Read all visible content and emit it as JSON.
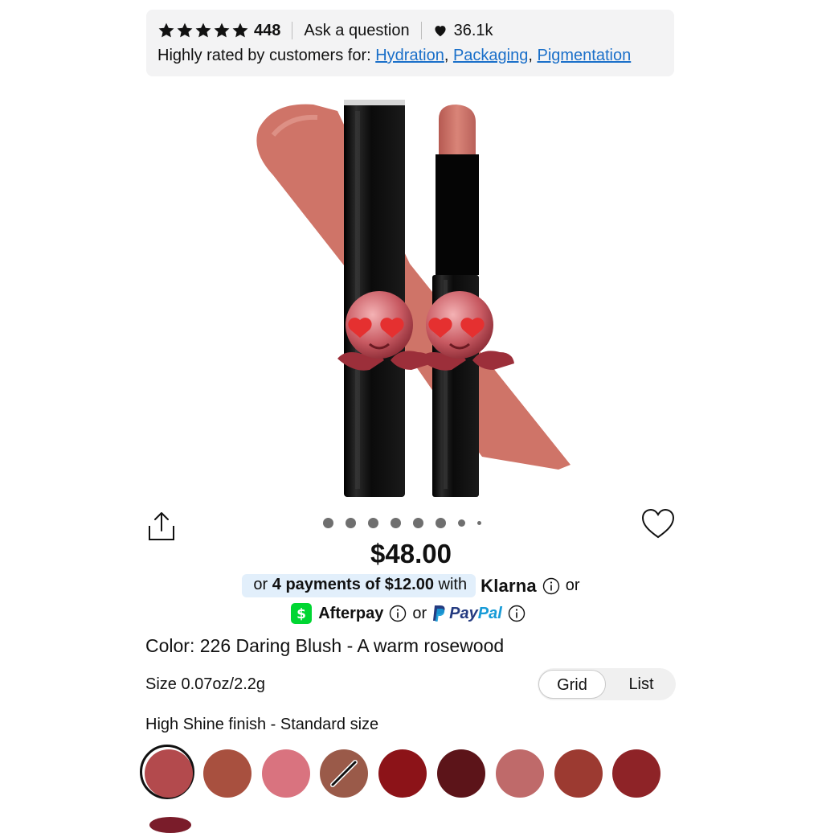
{
  "ratings": {
    "star_count": 5,
    "review_count": "448",
    "ask_question": "Ask a question",
    "loves": "36.1k",
    "highly_rated_prefix": "Highly rated by customers for: ",
    "highlights": [
      "Hydration",
      "Packaging",
      "Pigmentation"
    ]
  },
  "carousel": {
    "total_dots": 8,
    "active_index": 0
  },
  "price": "$48.00",
  "payments": {
    "prefix": "or ",
    "installment_text": "4 payments of $12.00",
    "with": " with",
    "klarna": "Klarna",
    "or": "or",
    "afterpay": "Afterpay",
    "paypal_pay": "Pay",
    "paypal_pal": "Pal"
  },
  "color_label": "Color: 226 Daring Blush - A warm rosewood",
  "size_label": "Size 0.07oz/2.2g",
  "view_toggle": {
    "grid": "Grid",
    "list": "List",
    "selected": "Grid"
  },
  "finish_label": "High Shine finish - Standard size",
  "swatches": [
    {
      "color": "#b34a4d",
      "selected": true
    },
    {
      "color": "#a8503f"
    },
    {
      "color": "#d9737f"
    },
    {
      "color": "#9a5a49",
      "crossed": true
    },
    {
      "color": "#8c1318"
    },
    {
      "color": "#5c1419"
    },
    {
      "color": "#bf6a6a"
    },
    {
      "color": "#9c3a31"
    },
    {
      "color": "#8e2327"
    }
  ],
  "colors": {
    "link": "#1a6fc9",
    "klarna_pill": "#e2effb",
    "cashapp": "#00d632",
    "lipstick_swatch": "#cf7468"
  }
}
